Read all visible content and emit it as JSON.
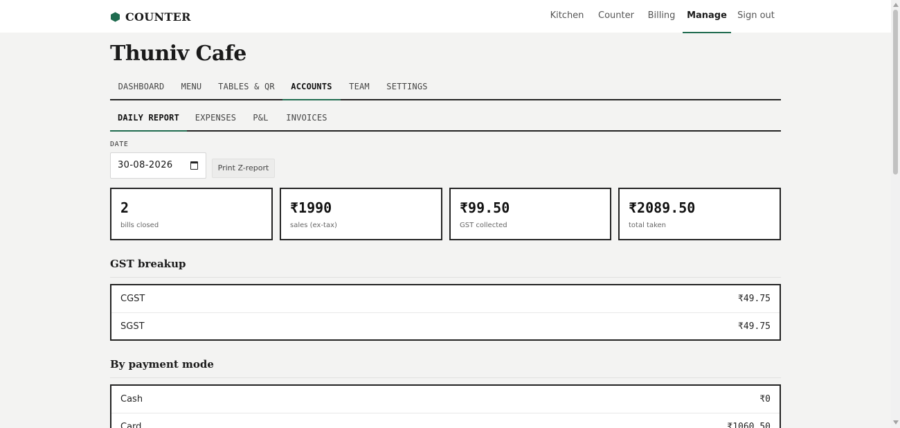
{
  "brand": {
    "name": "COUNTER",
    "accent": "#1f6b4f",
    "icon": "hexagon-icon"
  },
  "topnav": [
    {
      "label": "Kitchen",
      "active": false
    },
    {
      "label": "Counter",
      "active": false
    },
    {
      "label": "Billing",
      "active": false
    },
    {
      "label": "Manage",
      "active": true
    },
    {
      "label": "Sign out",
      "active": false
    }
  ],
  "page": {
    "title": "Thuniv Cafe"
  },
  "main_tabs": [
    {
      "label": "DASHBOARD",
      "active": false
    },
    {
      "label": "MENU",
      "active": false
    },
    {
      "label": "TABLES & QR",
      "active": false
    },
    {
      "label": "ACCOUNTS",
      "active": true
    },
    {
      "label": "TEAM",
      "active": false
    },
    {
      "label": "SETTINGS",
      "active": false
    }
  ],
  "sub_tabs": [
    {
      "label": "DAILY REPORT",
      "active": true
    },
    {
      "label": "EXPENSES",
      "active": false
    },
    {
      "label": "P&L",
      "active": false
    },
    {
      "label": "INVOICES",
      "active": false
    }
  ],
  "date": {
    "label": "DATE",
    "value": "30-08-2026",
    "icon": "calendar-icon"
  },
  "print_button": {
    "label": "Print Z-report"
  },
  "stats": [
    {
      "value": "2",
      "label": "bills closed"
    },
    {
      "value": "₹1990",
      "label": "sales (ex-tax)"
    },
    {
      "value": "₹99.50",
      "label": "GST collected"
    },
    {
      "value": "₹2089.50",
      "label": "total taken"
    }
  ],
  "gst_breakup": {
    "title": "GST breakup",
    "rows": [
      {
        "label": "CGST",
        "amount": "₹49.75"
      },
      {
        "label": "SGST",
        "amount": "₹49.75"
      }
    ]
  },
  "payment_mode": {
    "title": "By payment mode",
    "rows": [
      {
        "label": "Cash",
        "amount": "₹0"
      },
      {
        "label": "Card",
        "amount": "₹1060.50"
      }
    ]
  }
}
